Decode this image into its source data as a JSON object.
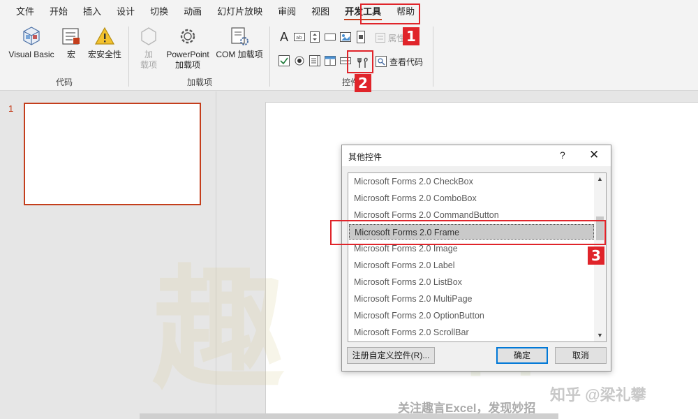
{
  "menubar": {
    "tabs": [
      "文件",
      "开始",
      "插入",
      "设计",
      "切换",
      "动画",
      "幻灯片放映",
      "审阅",
      "视图",
      "开发工具",
      "帮助"
    ],
    "active_tab": "开发工具"
  },
  "ribbon": {
    "code_group": {
      "label": "代码",
      "visual_basic": "Visual Basic",
      "macro": "宏",
      "macro_security": "宏安全性"
    },
    "addins_group": {
      "label": "加载项",
      "addin_line1": "加",
      "addin_line2": "载项",
      "ppt_addin_line1": "PowerPoint",
      "ppt_addin_line2": "加载项",
      "com_addin": "COM 加载项"
    },
    "controls_group": {
      "label_visible": "控件",
      "properties": "属性",
      "view_code": "查看代码"
    }
  },
  "slides": {
    "thumbnail_number": "1"
  },
  "dialog": {
    "title": "其他控件",
    "help": "?",
    "close": "✕",
    "items": [
      "Microsoft Forms 2.0 CheckBox",
      "Microsoft Forms 2.0 ComboBox",
      "Microsoft Forms 2.0 CommandButton",
      "Microsoft Forms 2.0 Frame",
      "Microsoft Forms 2.0 Image",
      "Microsoft Forms 2.0 Label",
      "Microsoft Forms 2.0 ListBox",
      "Microsoft Forms 2.0 MultiPage",
      "Microsoft Forms 2.0 OptionButton",
      "Microsoft Forms 2.0 ScrollBar"
    ],
    "selected_item": "Microsoft Forms 2.0 Frame",
    "register_button": "注册自定义控件(R)...",
    "ok_button": "确定",
    "cancel_button": "取消"
  },
  "annotations": {
    "step1": "1",
    "step2": "2",
    "step3": "3",
    "color": "#e0242a"
  },
  "watermark": {
    "big_char": "趣",
    "big_char2": "言",
    "footer": "关注趣言Excel，发现妙招",
    "zhihu": "知乎 @梁礼攀"
  },
  "colors": {
    "accent": "#c43e1c",
    "dialog_default_border": "#0078d7"
  }
}
